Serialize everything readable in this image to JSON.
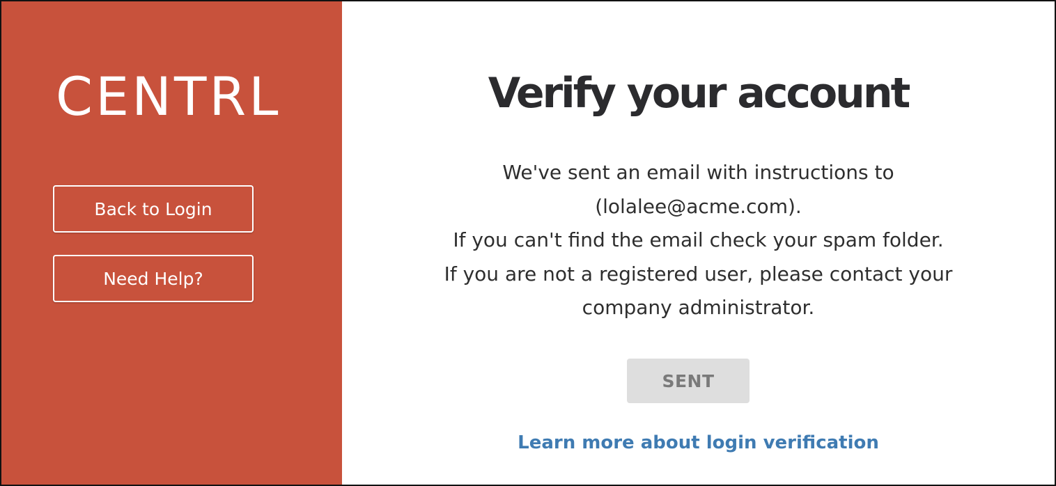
{
  "sidebar": {
    "logo_text": "CENTRL",
    "back_to_login_label": "Back to Login",
    "need_help_label": "Need Help?"
  },
  "main": {
    "title": "Verify your account",
    "message_lines": [
      "We've sent an email with instructions to",
      "(lolalee@acme.com).",
      "If you can't find the email check your spam folder.",
      "If you are not a registered user, please contact your",
      "company administrator."
    ],
    "sent_button_label": "SENT",
    "learn_more_link": "Learn more about login verification"
  },
  "colors": {
    "sidebar_background": "#c8523c",
    "title_text": "#2b2b2e",
    "link": "#3f7bb2",
    "disabled_button": "#dedede"
  }
}
